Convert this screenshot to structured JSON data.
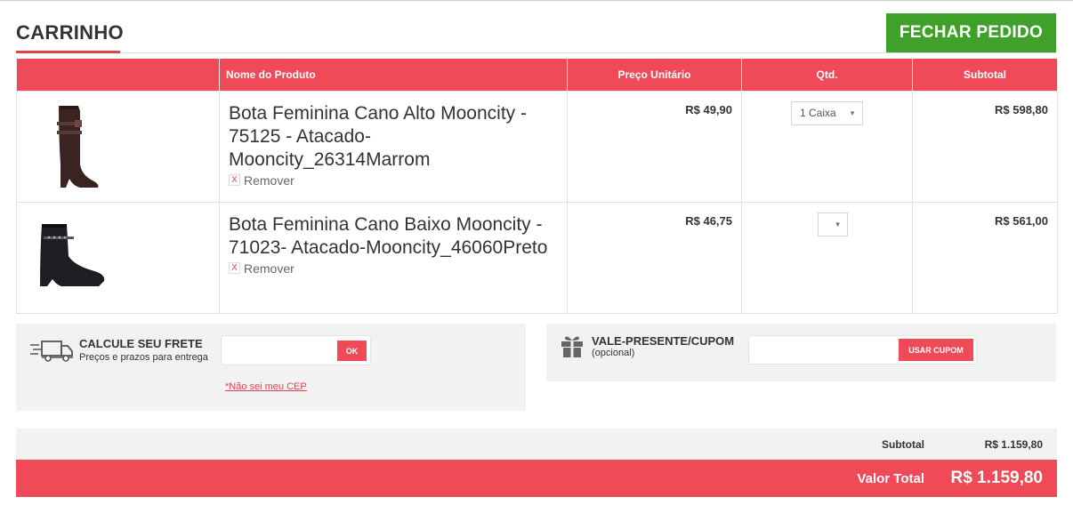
{
  "header": {
    "title": "CARRINHO",
    "checkout_label": "FECHAR PEDIDO"
  },
  "table": {
    "columns": [
      "",
      "Nome do Produto",
      "Preço Unitário",
      "Qtd.",
      "Subtotal"
    ],
    "rows": [
      {
        "image": "tall-brown-boot",
        "name": "Bota Feminina Cano Alto Mooncity - 75125 - Atacado-Mooncity_26314Marrom",
        "remove_label": "Remover",
        "remove_icon": "X",
        "unit_price": "R$ 49,90",
        "qty": "1 Caixa",
        "subtotal": "R$ 598,80"
      },
      {
        "image": "black-ankle-boot",
        "name": "Bota Feminina Cano Baixo Mooncity - 71023- Atacado-Mooncity_46060Preto",
        "remove_label": "Remover",
        "remove_icon": "X",
        "unit_price": "R$ 46,75",
        "qty": "",
        "subtotal": "R$ 561,00"
      }
    ]
  },
  "shipping": {
    "title": "CALCULE SEU FRETE",
    "subtitle": "Preços e prazos para entrega",
    "input_value": "",
    "button_label": "OK",
    "cep_link": "*Não sei meu CEP",
    "icon": "truck-icon"
  },
  "coupon": {
    "title": "VALE-PRESENTE/CUPOM",
    "subtitle": "(opcional)",
    "input_value": "",
    "button_label": "USAR CUPOM",
    "icon": "gift-icon"
  },
  "totals": {
    "subtotal_label": "Subtotal",
    "subtotal_value": "R$ 1.159,80",
    "total_label": "Valor Total",
    "total_value": "R$ 1.159,80"
  },
  "colors": {
    "accent": "#f04a58",
    "checkout_green": "#3fa12a",
    "panel_bg": "#f2f2f2"
  }
}
